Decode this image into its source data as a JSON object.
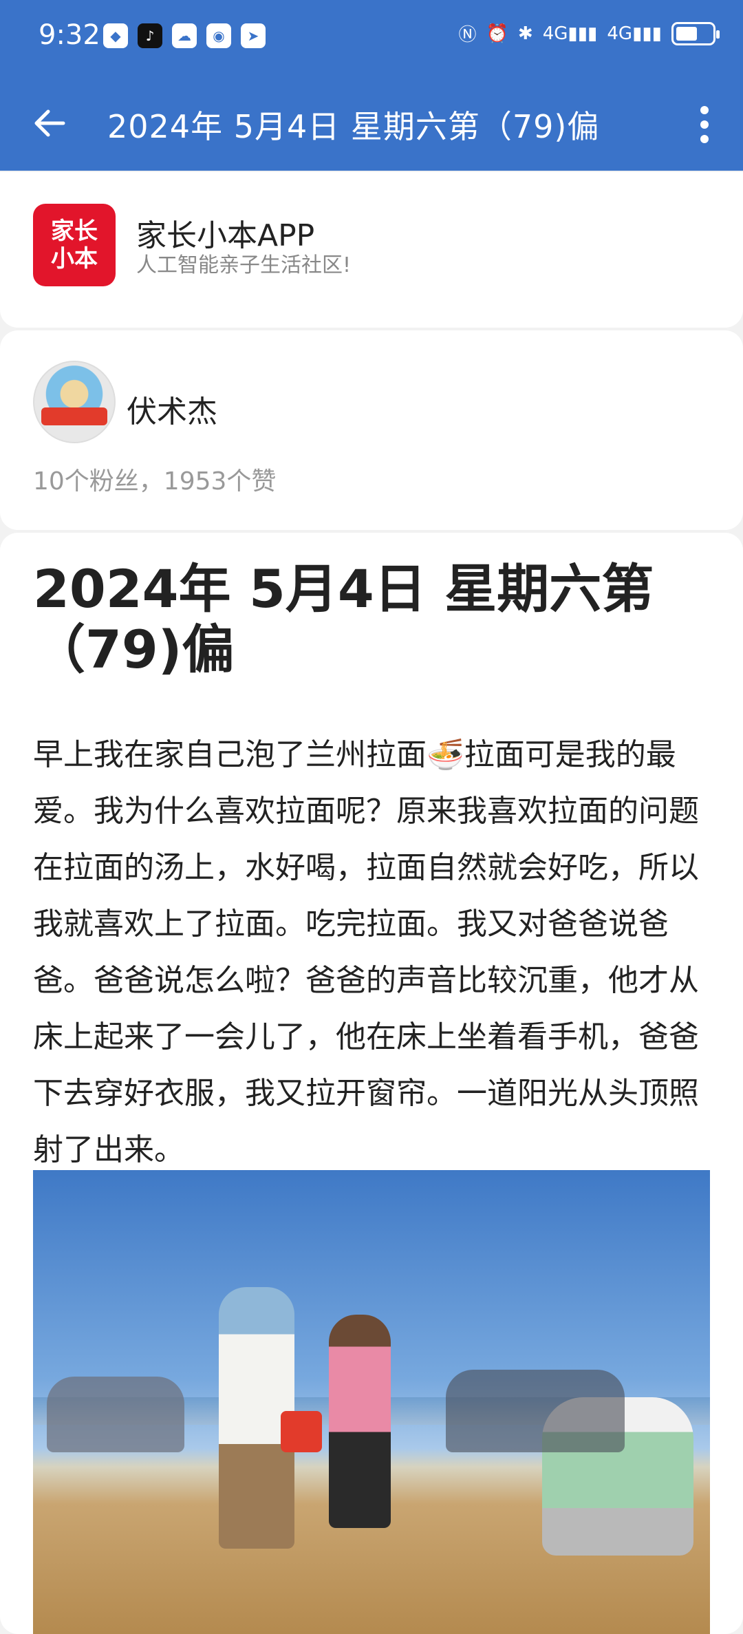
{
  "status_bar": {
    "time": "9:32",
    "icons": [
      "shield-app-icon",
      "tiktok-icon",
      "cloud-app-icon",
      "map-app-icon",
      "nav-app-icon"
    ],
    "right_icons": [
      "nfc-icon",
      "alarm-icon",
      "bluetooth-icon",
      "signal-4g-icon",
      "signal-4g-icon-2",
      "battery-icon"
    ],
    "network_label_1": "4G",
    "network_label_2": "4G",
    "battery_level": 0.5
  },
  "appbar": {
    "title": "2024年 5月4日 星期六第（79)偏"
  },
  "app_card": {
    "logo_line1": "家长",
    "logo_line2": "小本",
    "name": "家长小本APP",
    "slogan": "人工智能亲子生活社区!"
  },
  "author": {
    "name": "伏术杰",
    "stats": "10个粉丝，1953个赞"
  },
  "article": {
    "title": "2024年 5月4日 星期六第（79)偏",
    "body": "早上我在家自己泡了兰州拉面🍜拉面可是我的最爱。我为什么喜欢拉面呢？原来我喜欢拉面的问题在拉面的汤上，水好喝，拉面自然就会好吃，所以我就喜欢上了拉面。吃完拉面。我又对爸爸说爸爸。爸爸说怎么啦？爸爸的声音比较沉重，他才从床上起来了一会儿了，他在床上坐着看手机，爸爸下去穿好衣服，我又拉开窗帘。一道阳光从头顶照射了出来。"
  },
  "colors": {
    "brand_blue": "#3a73c9",
    "logo_red": "#e2152b"
  }
}
